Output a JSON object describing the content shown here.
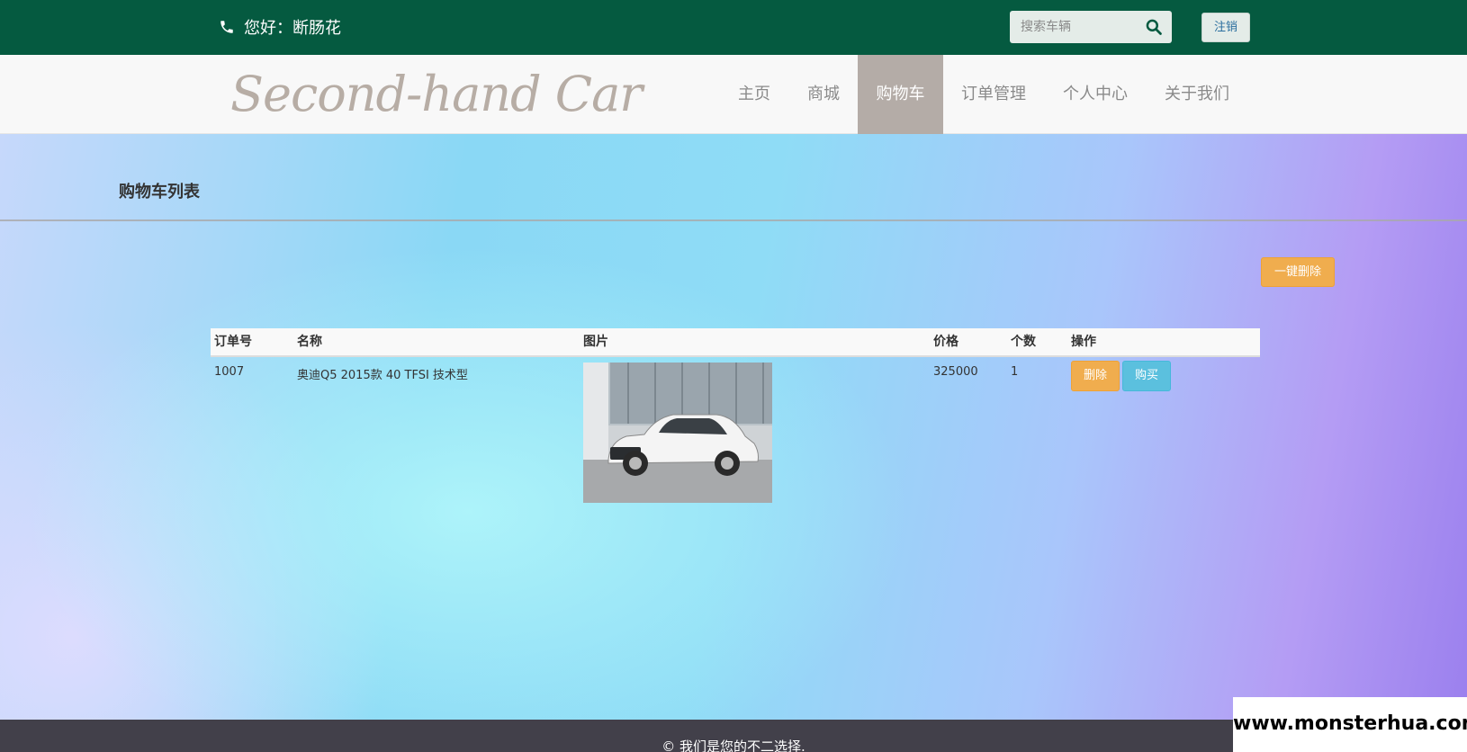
{
  "topbar": {
    "greeting": "您好：断肠花",
    "search_placeholder": "搜索车辆",
    "logout_label": "注销"
  },
  "brand": {
    "logo_text": "Second-hand Car"
  },
  "nav": {
    "items": [
      {
        "label": "主页"
      },
      {
        "label": "商城"
      },
      {
        "label": "购物车"
      },
      {
        "label": "订单管理"
      },
      {
        "label": "个人中心"
      },
      {
        "label": "关于我们"
      }
    ],
    "active_index": 2
  },
  "page": {
    "heading": "购物车列表",
    "delete_all_label": "一键删除"
  },
  "table": {
    "columns": [
      "订单号",
      "名称",
      "图片",
      "价格",
      "个数",
      "操作"
    ],
    "rows": [
      {
        "order_no": "1007",
        "name": "奥迪Q5 2015款 40 TFSI 技术型",
        "price": "325000",
        "quantity": "1",
        "delete_label": "删除",
        "buy_label": "购买"
      }
    ]
  },
  "footer": {
    "text": "© 我们是您的不二选择."
  },
  "watermark": {
    "text": "www.monsterhua.com"
  },
  "colors": {
    "topbar": "#055a40",
    "nav_active": "#b4aca7",
    "warning": "#f0ad4e",
    "info": "#5bc0de"
  }
}
